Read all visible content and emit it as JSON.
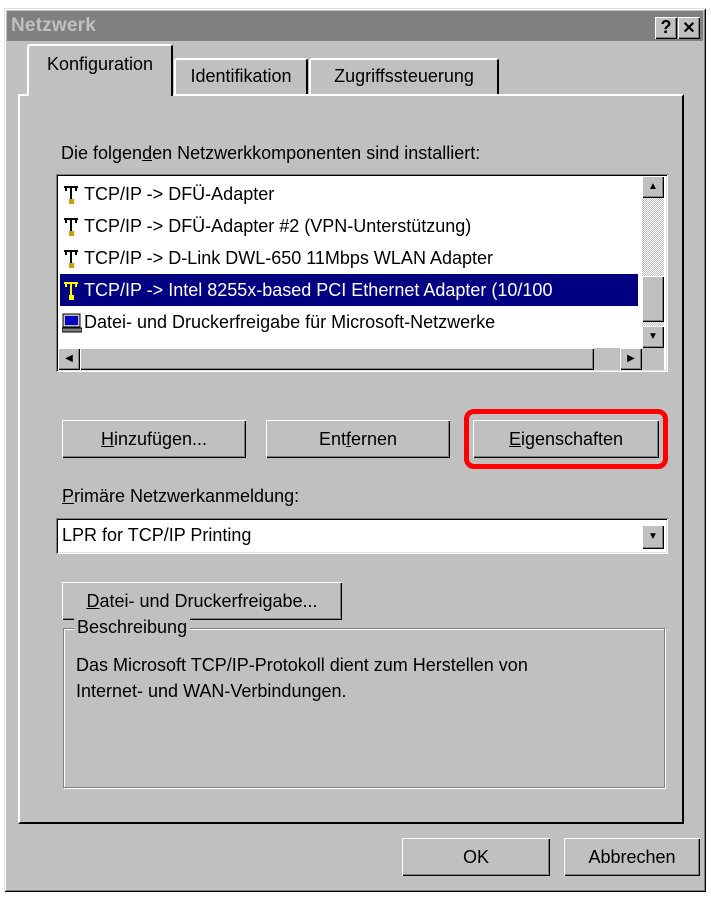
{
  "window": {
    "title": "Netzwerk",
    "help_glyph": "?",
    "close_glyph": "✕"
  },
  "tabs": [
    {
      "label": "Konfiguration",
      "active": true
    },
    {
      "label": "Identifikation",
      "active": false
    },
    {
      "label": "Zugriffssteuerung",
      "active": false
    }
  ],
  "components": {
    "heading_pre": "Die folgen",
    "heading_hotkey": "d",
    "heading_post": "en Netzwerkkomponenten sind installiert:",
    "items": [
      {
        "label": "TCP/IP -> DFÜ-Adapter",
        "icon": "network-protocol-icon",
        "selected": false
      },
      {
        "label": "TCP/IP -> DFÜ-Adapter #2 (VPN-Unterstützung)",
        "icon": "network-protocol-icon",
        "selected": false
      },
      {
        "label": "TCP/IP -> D-Link DWL-650 11Mbps WLAN Adapter",
        "icon": "network-protocol-icon",
        "selected": false
      },
      {
        "label": "TCP/IP -> Intel 8255x-based PCI Ethernet Adapter (10/100",
        "icon": "network-protocol-icon",
        "selected": true
      },
      {
        "label": "Datei- und Druckerfreigabe für Microsoft-Netzwerke",
        "icon": "computer-share-icon",
        "selected": false
      }
    ]
  },
  "buttons": {
    "add": {
      "hotkey": "H",
      "rest": "inzufügen..."
    },
    "remove": {
      "pre": "Ent",
      "hotkey": "f",
      "post": "ernen"
    },
    "properties": {
      "hotkey": "E",
      "rest": "igenschaften"
    },
    "file_sharing": {
      "hotkey": "D",
      "rest": "atei- und Druckerfreigabe..."
    },
    "ok": "OK",
    "cancel": "Abbrechen"
  },
  "logon": {
    "label_hotkey": "P",
    "label_rest": "rimäre Netzwerkanmeldung:",
    "value": "LPR for TCP/IP Printing"
  },
  "description": {
    "title": "Beschreibung",
    "text_line1": "Das Microsoft TCP/IP-Protokoll dient zum Herstellen von",
    "text_line2": "Internet- und WAN-Verbindungen."
  },
  "colors": {
    "highlight_annotation": "#ff0000",
    "selection": "#000080",
    "titlebar": "#808080"
  }
}
